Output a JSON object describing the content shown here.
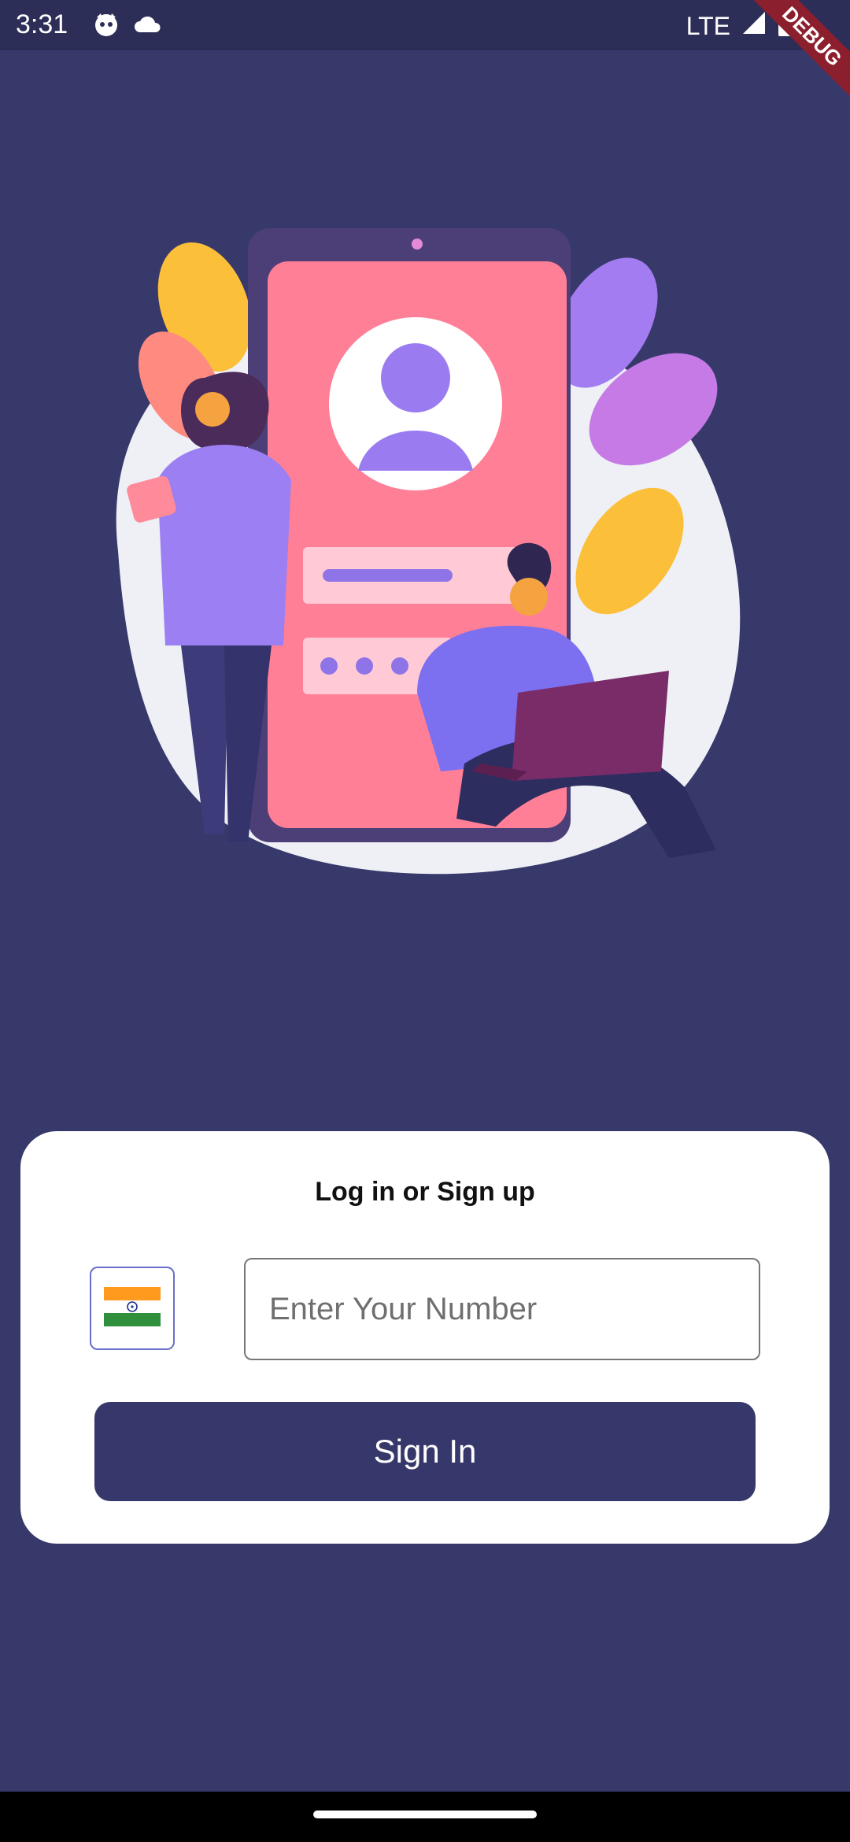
{
  "status_bar": {
    "time": "3:31",
    "network": "LTE",
    "left_icons": [
      "cat-notification-icon",
      "cloud-icon"
    ],
    "right_icons": [
      "signal-icon",
      "battery-icon"
    ]
  },
  "debug_banner": "DEBUG",
  "illustration": {
    "icon": "login-illustration",
    "colors": {
      "background_blob": "#eef0f6",
      "phone": "#ff7f97",
      "avatar": "#9b7cf0"
    }
  },
  "login_card": {
    "title": "Log in or Sign up",
    "country_flag_icon": "india-flag-icon",
    "phone_input": {
      "placeholder": "Enter Your Number",
      "value": ""
    },
    "sign_in_label": "Sign In"
  },
  "colors": {
    "background": "#38396b",
    "status_bar": "#2d2e58",
    "card": "#ffffff",
    "primary_button": "#36376a",
    "flag_border": "#6b6fc9"
  }
}
